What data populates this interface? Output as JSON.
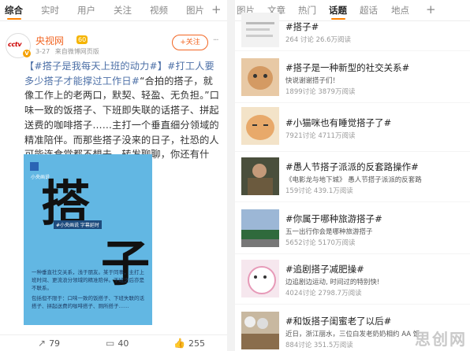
{
  "left_tabs": [
    "综合",
    "实时",
    "用户",
    "关注",
    "视频",
    "图片"
  ],
  "left_plus": "+",
  "post": {
    "author": "央视网",
    "level": "60",
    "date": "3-27",
    "source": "来自微博网页版",
    "follow": "+关注",
    "avatar_logo": "cctv",
    "text_parts": [
      {
        "t": "【#搭子是我每天上班的动力#】",
        "c": "ht"
      },
      {
        "t": "#打工人要多少搭子才能撑过工作日#",
        "c": "ht"
      },
      {
        "t": "“合拍的搭子，就像工作上的老两口，默契、轻盈、无负担。”口味一致的饭搭子、下班即失联的话搭子、拼起送费的咖啡搭子……主打一个垂直细分领域的精准陪伴。而那些搭子没来的日子，社恐的人可能连食堂都不想去。转发聊聊，你还有什么...",
        "c": "plain"
      },
      {
        "t": " 全文",
        "c": "full"
      }
    ],
    "poster": {
      "mini": "小央画说",
      "big1": "搭",
      "big2": "子",
      "credit": "#小央画说 字幕延时",
      "body": [
        "一种垂直社交关系，浅于朋友。某于同事，主打上班时间、更流浪分领域的精准陪伴。下班之后亦是不联系。",
        "包括但不限于：口味一致的饭搭子、下班失联的话搭子、拼起送费的咖啡搭子、厕所搭子……"
      ]
    }
  },
  "footer": {
    "repost": "79",
    "comment": "40",
    "like": "255"
  },
  "right_tabs": [
    "图片",
    "文章",
    "热门",
    "话题",
    "超话",
    "地点"
  ],
  "right_plus": "+",
  "topics": [
    {
      "title": "#搭子#",
      "sub": "",
      "stat": "264 讨论 26.6万阅读"
    },
    {
      "title": "#搭子是一种新型的社交关系#",
      "sub": "快说谢谢搭子们！",
      "stat": "1899讨论 3879万阅读"
    },
    {
      "title": "#小猫咪也有睡觉搭子了#",
      "sub": "",
      "stat": "7921讨论 4711万阅读"
    },
    {
      "title": "#愚人节搭子派派的反套路操作#",
      "sub": "《电影龙与地下城》 愚人节搭子派派的反套路",
      "stat": "159讨论 439.1万阅读"
    },
    {
      "title": "#你属于哪种旅游搭子#",
      "sub": "五一出行你会是哪种旅游搭子",
      "stat": "5652讨论 5170万阅读"
    },
    {
      "title": "#追剧搭子减肥操#",
      "sub": "边追剧边运动, 时间过的特别快!",
      "stat": "4024讨论 2798.7万阅读"
    },
    {
      "title": "#和饭搭子闺蜜老了以后#",
      "sub": "近日，浙江丽水，三位白发老奶奶相约 AA 饭",
      "stat": "884讨论 351.5万阅读"
    }
  ],
  "watermark": "思创网"
}
